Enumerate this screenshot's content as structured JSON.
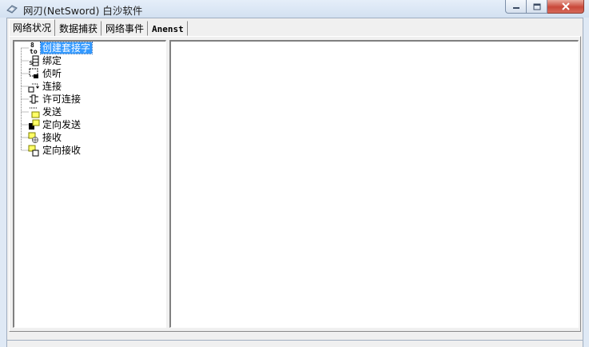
{
  "window": {
    "title": "网刃(NetSword) 白沙软件",
    "app_icon": "netsword-app-icon",
    "caption_buttons": [
      "minimize-icon",
      "maximize-icon",
      "close-icon"
    ],
    "colors": {
      "title_bg": "#d3e1f1",
      "close_btn": "#c9483a",
      "selection": "#3399ff"
    }
  },
  "tabs": [
    {
      "label": "网络状况",
      "active": true
    },
    {
      "label": "数据捕获",
      "active": false
    },
    {
      "label": "网络事件",
      "active": false
    },
    {
      "label": "Anenst",
      "active": false
    }
  ],
  "tree": {
    "items": [
      {
        "label": "创建套接字",
        "icon": "create-socket-icon",
        "selected": true
      },
      {
        "label": "绑定",
        "icon": "bind-icon",
        "selected": false
      },
      {
        "label": "侦听",
        "icon": "listen-icon",
        "selected": false
      },
      {
        "label": "连接",
        "icon": "connect-icon",
        "selected": false
      },
      {
        "label": "许可连接",
        "icon": "accept-icon",
        "selected": false
      },
      {
        "label": "发送",
        "icon": "send-icon",
        "selected": false
      },
      {
        "label": "定向发送",
        "icon": "sendto-icon",
        "selected": false
      },
      {
        "label": "接收",
        "icon": "receive-icon",
        "selected": false
      },
      {
        "label": "定向接收",
        "icon": "recvfrom-icon",
        "selected": false
      }
    ]
  }
}
